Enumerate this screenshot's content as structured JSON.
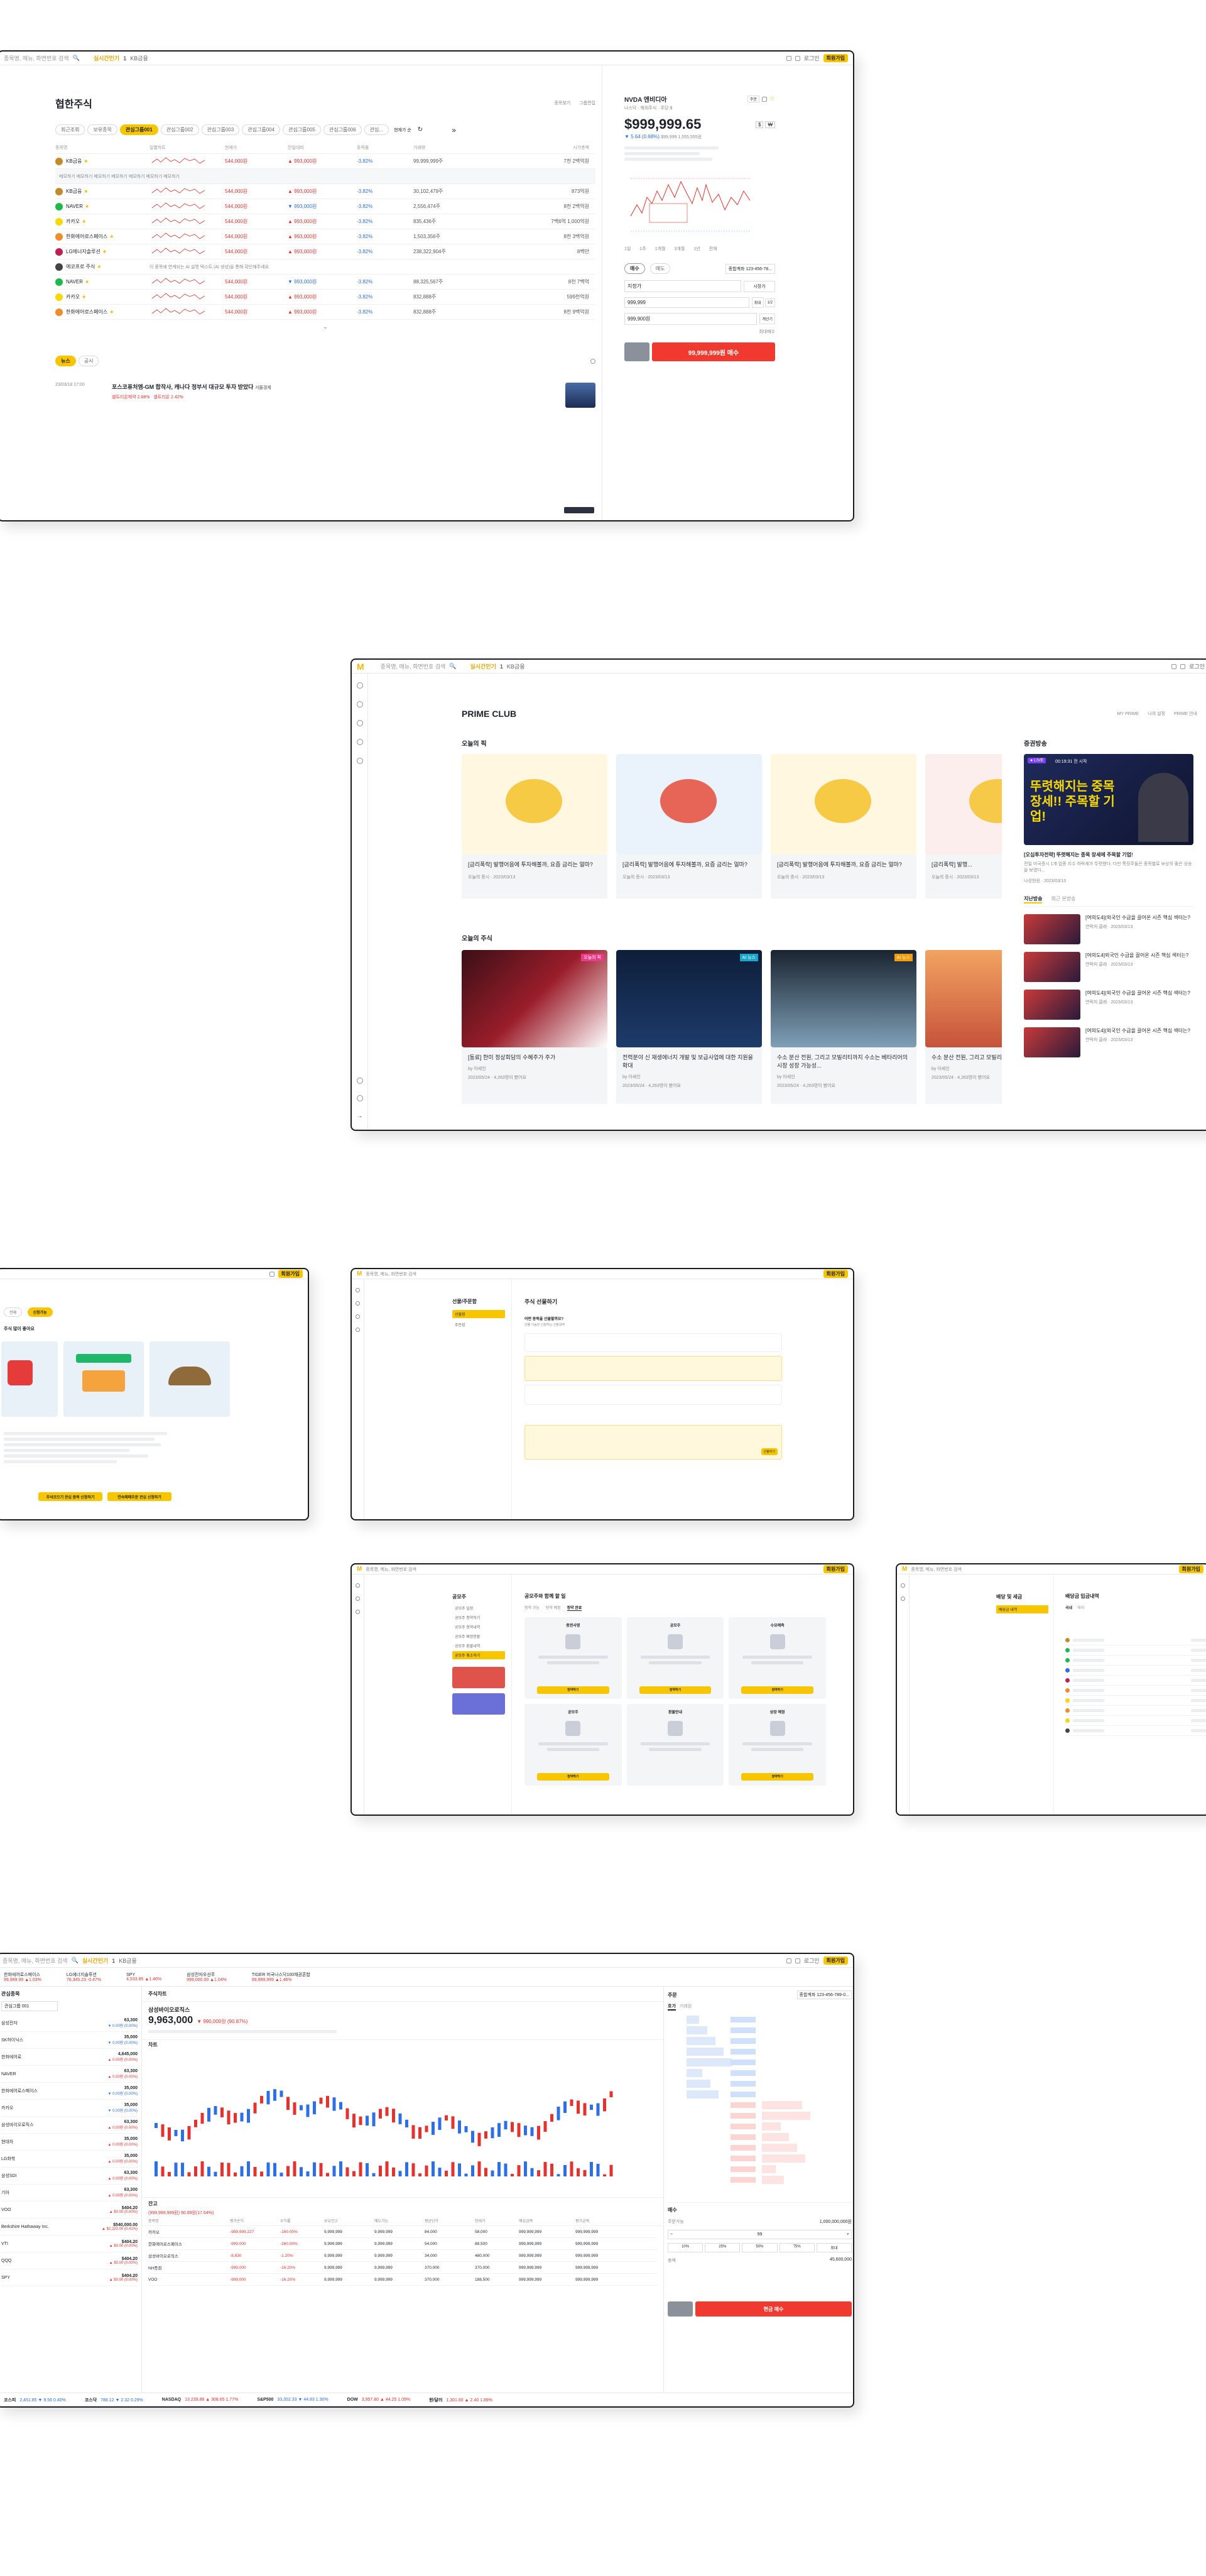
{
  "common": {
    "search_placeholder": "종목명, 메뉴, 화면번호 검색",
    "realtime_label": "실시간인기",
    "realtime_rank": "1",
    "realtime_stock": "KB금융",
    "login_label": "로그인",
    "signup_label": "회원가입",
    "logo_letter": "M"
  },
  "screen1": {
    "page_title": "협한주식",
    "header_links": [
      "종목찾기",
      "그룹편집"
    ],
    "tabs": [
      "최근조회",
      "보유종목",
      "관심그룹001",
      "관심그룹002",
      "관심그룹003",
      "관심그룹004",
      "관심그룹005",
      "관심그룹006",
      "관심..."
    ],
    "sort_label": "현재가 순",
    "columns": [
      "종목명",
      "일별차트",
      "현재가",
      "전일대비",
      "등락률",
      "거래량",
      "시가총액"
    ],
    "rows": [
      {
        "name": "KB금융",
        "price": "544,000원",
        "change": "▲ 993,000원",
        "rate": "-3.82%",
        "volume": "99,999,999주",
        "cap": "7천 2백억원",
        "color": "#c28a2b",
        "type": "stock"
      },
      {
        "name": "",
        "note": "메모하기 메모하기 메모하기 메모하기 메모하기 메모하기 메모하기",
        "type": "memo"
      },
      {
        "name": "KB금융",
        "price": "544,000원",
        "change": "▲ 993,000원",
        "rate": "-3.82%",
        "volume": "30,102,479주",
        "cap": "873억원",
        "color": "#c28a2b",
        "type": "stock"
      },
      {
        "name": "NAVER",
        "price": "544,000원",
        "change": "▼ 993,000원",
        "rate": "-3.82%",
        "volume": "2,556,474주",
        "cap": "8천 2백억원",
        "color": "#1fb84a",
        "type": "stock"
      },
      {
        "name": "카카오",
        "price": "544,000원",
        "change": "▲ 993,000원",
        "rate": "-3.82%",
        "volume": "835,436주",
        "cap": "7백6억 1,000억원",
        "color": "#f7d800",
        "type": "stock"
      },
      {
        "name": "한화에어로스페이스",
        "price": "544,000원",
        "change": "▲ 993,000원",
        "rate": "-3.82%",
        "volume": "1,503,356주",
        "cap": "8천 3백억원",
        "color": "#f08c2a",
        "type": "stock"
      },
      {
        "name": "LG에너지솔루션",
        "price": "544,000원",
        "change": "▲ 993,000원",
        "rate": "-3.82%",
        "volume": "238,322,904주",
        "cap": "8백만",
        "color": "#c01f4f",
        "type": "stock"
      },
      {
        "name": "에코프로 주식",
        "note": "이 종목에 연계되는 AI 설명 텍스트 (AI 생성)을 통해 확인해주세요",
        "color": "#444",
        "type": "info"
      },
      {
        "name": "NAVER",
        "price": "544,000원",
        "change": "▼ 993,000원",
        "rate": "-3.82%",
        "volume": "88,325,567주",
        "cap": "8천 7백억",
        "color": "#1fb84a",
        "type": "stock"
      },
      {
        "name": "카카오",
        "price": "544,000원",
        "change": "▲ 993,000원",
        "rate": "-3.82%",
        "volume": "832,888주",
        "cap": "599천억원",
        "color": "#f7d800",
        "type": "stock"
      },
      {
        "name": "한화에어로스페이스",
        "price": "544,000원",
        "change": "▲ 993,000원",
        "rate": "-3.82%",
        "volume": "832,888주",
        "cap": "8천 9백억원",
        "color": "#f08c2a",
        "type": "stock"
      }
    ],
    "news_tabs": [
      "뉴스",
      "공시"
    ],
    "news_date": "23/03/18 17:00",
    "news_headline": "포스코퓨처엠-GM 합작사, 캐나다 정부서 대규모 투자 받았다",
    "news_source": "서울경제",
    "news_related": [
      "셀트리온제약 2.88%",
      "셀트리온 2.42%"
    ],
    "side": {
      "stock_name": "NVDA 엔비디아",
      "stock_sub": "나스닥 · 해외주식 · 주당 $",
      "price": "$999,999.65",
      "change": "▼ 5.64 (0.68%)",
      "change_extra": "$99,999 1,555,555원",
      "chart_labels": [
        "1일",
        "1주",
        "1개월",
        "3개월",
        "1년",
        "전체"
      ],
      "order_tabs": [
        "매수",
        "매도"
      ],
      "account": "종합계좌 123-456-78...",
      "qty_label": "지정가",
      "price_val": "999,999",
      "qty_val": "999,900원",
      "qty_buttons": [
        "10%",
        "25%",
        "50%",
        "전체"
      ],
      "buy_button": "99,999,999원 매수",
      "max_buy": "최대매수"
    }
  },
  "screen2": {
    "title": "PRIME CLUB",
    "top_links": [
      "MY PRIME",
      "나의 설정",
      "PRIME 안내"
    ],
    "section1": "오늘의 픽",
    "picks": [
      {
        "title": "[금리폭락] 발행어음에 투자해볼까, 요즘 금리는 얼마?",
        "meta": "오늘의 증시 · 2023/03/13",
        "bg": "#fff7df"
      },
      {
        "title": "[금리폭락] 발행어음에 투자해볼까, 요즘 금리는 얼마?",
        "meta": "오늘의 증시 · 2023/03/13",
        "bg": "#eaf3fb"
      },
      {
        "title": "[금리폭락] 발행어음에 투자해볼까, 요즘 금리는 얼마?",
        "meta": "오늘의 증시 · 2023/03/13",
        "bg": "#fff7df"
      },
      {
        "title": "[금리폭락] 발행...",
        "meta": "오늘의 증시 · 2023/03/13",
        "bg": "#fdeeee"
      }
    ],
    "section2": "오늘의 주식",
    "stocks": [
      {
        "title": "[동료] 한미 정상회담의 수혜주가 주가",
        "by": "by 아세인",
        "meta": "2023/05/24 · 4,263명이 봤어요",
        "tag": "오늘의 픽",
        "tagcolor": "#e93b8a"
      },
      {
        "title": "전력분야 신 재생에너지 개발 및 보급사업에 대한 지원을 확대",
        "by": "by 아세인",
        "meta": "2023/05/24 · 4,263명이 봤어요",
        "tag": "AI 뉴스",
        "tagcolor": "#19a7c9"
      },
      {
        "title": "수소 분산 전원, 그리고 모빌리티까지 수소는 베타리어의 시장 성장 가능성...",
        "by": "by 아세인",
        "meta": "2023/05/24 · 4,263명이 봤어요",
        "tag": "AI 뉴스",
        "tagcolor": "#f59c0b"
      },
      {
        "title": "수소 분산 전원, 그리고 모빌리티까지 수소는 베타리어...",
        "by": "by 아세인",
        "meta": "2023/05/24 · 4,263명이 봤어요",
        "tag": "",
        "tagcolor": ""
      }
    ],
    "broadcast_title": "증권방송",
    "live_label": "● LIVE",
    "live_time": "00:19:31 전 시작",
    "broadcast_headline": "뚜렷해지는 중목 장세!! 주목할 기업!",
    "broadcast_sub": "[오십투자전략] 뚜렷해지는 종목 장세에 주목할 기업!",
    "broadcast_desc": "전일 미국증시 1개 업종 지수 하락세가 뚜렷했다. 다만 특징주들은 종목별로 보상의 좋은 상승을 보였다...",
    "broadcast_date": "나성현원 · 2023/03/13",
    "broadcast_tabs": [
      "지난방송",
      "최근 본방송"
    ],
    "past": [
      {
        "title": "[여의도4](외국인 수급을 끌어온 시즌 핵심 섹터는?",
        "meta": "연락처 클래 · 2023/03/13"
      },
      {
        "title": "[여의도4]외국인 수급을 끌어온 시즌 핵심 섹터는?",
        "meta": "연락처 클래 · 2023/03/13"
      },
      {
        "title": "[여의도4](외국인 수급을 끌어온 시즌 핵심 섹터는?",
        "meta": "연락처 클래 · 2023/03/13"
      },
      {
        "title": "[여의도4](외국인 수급을 끌어온 시즌 핵심 섹터는?",
        "meta": "연락처 클래 · 2023/03/13"
      }
    ]
  },
  "screen3": {
    "chips": [
      "전체",
      "신청가능"
    ],
    "subhead": "주식 많이 좋아요",
    "btn1": "주식모으기 관심 종목 신청하기",
    "btn2": "연속매매주문 관심 신청하기"
  },
  "screen4": {
    "menu_title": "선물/주문함",
    "menu_items": [
      "선물함",
      "주문함"
    ],
    "title": "주식 선물하기",
    "subtitle": "어떤 종목을 선물할까요?",
    "notice": "선물 가능한 신청하는 신청내역",
    "btn": "선물하기"
  },
  "screen5": {
    "menu_title": "공모주",
    "menu_items": [
      "공모주 일정",
      "공모주 청약하기",
      "공모주 청약내역",
      "공모주 배정현황",
      "공모주 환불내역",
      "공모주 취소하기"
    ],
    "title": "공모주와 함께 할 일",
    "tabs": [
      "청약 가능",
      "청약 예정",
      "청약 완료"
    ],
    "cards": [
      "증권사명",
      "공모주",
      "수요예측",
      "공모주",
      "환불안내",
      "상장 예정"
    ],
    "btn": "청약하기"
  },
  "screen6": {
    "menu_title": "배당 및 세금",
    "menu_items": [
      "배당금 내역"
    ],
    "title": "배당금 입금내역",
    "tabs": [
      "국내",
      "해외"
    ]
  },
  "screen7": {
    "ticker_bar": [
      {
        "name": "한화에어로스페이스",
        "val": "99,999.99 ▲1.03%"
      },
      {
        "name": "LG에너지솔루션",
        "val": "78,345.23 -0.47%"
      },
      {
        "name": "SPY",
        "val": "4,533.85 ▲1.46%"
      },
      {
        "name": "삼성전자우선주",
        "val": "999,000.00 ▲1.04%"
      },
      {
        "name": "TIGER 미국나스닥100채권혼합",
        "val": "99,999,999 ▲1.46%"
      }
    ],
    "watch_title": "관심종목",
    "watch_group": "관심그룹 001",
    "watch": [
      {
        "name": "삼성전자",
        "price": "63,300",
        "chg": "▼ 0.00원 (0.00%)"
      },
      {
        "name": "SK하이닉스",
        "price": "35,000",
        "chg": "▼ 0.00원 (0.00%)"
      },
      {
        "name": "한화에어로",
        "price": "4,645,000",
        "chg": "▲ 0.00원 (0.00%)"
      },
      {
        "name": "NAVER",
        "price": "63,300",
        "chg": "▲ 0.00원 (0.00%)"
      },
      {
        "name": "한화에어로스페이스",
        "price": "35,000",
        "chg": "▼ 0.00원 (0.00%)"
      },
      {
        "name": "카카오",
        "price": "35,000",
        "chg": "▼ 0.00원 (0.00%)"
      },
      {
        "name": "삼성바이오로직스",
        "price": "63,300",
        "chg": "▲ 0.00원 (0.00%)"
      },
      {
        "name": "현대차",
        "price": "35,000",
        "chg": "▲ 0.00원 (0.00%)"
      },
      {
        "name": "LG화학",
        "price": "35,000",
        "chg": "▲ 0.00원 (0.00%)"
      },
      {
        "name": "삼성SDI",
        "price": "63,300",
        "chg": "▲ 0.00원 (0.00%)"
      },
      {
        "name": "기아",
        "price": "63,300",
        "chg": "▲ 0.00원 (0.00%)"
      },
      {
        "name": "VOO",
        "price": "$404.20",
        "chg": "▲ $0.00 (0.00%)"
      },
      {
        "name": "Berkshire Hathaway Inc.",
        "price": "$540,000.00",
        "chg": "▲ $2,220.00 (0.41%)"
      },
      {
        "name": "VTI",
        "price": "$404.20",
        "chg": "▲ $0.00 (0.00%)"
      },
      {
        "name": "QQQ",
        "price": "$404.20",
        "chg": "▲ $0.00 (0.00%)"
      },
      {
        "name": "SPY",
        "price": "$404.20",
        "chg": "▲ $0.00 (0.00%)"
      }
    ],
    "main_title": "주식차트",
    "stock_name": "삼성바이오로직스",
    "stock_price": "9,963,000",
    "stock_chg": "▼ 990,000원 (90.87%)",
    "chart_section": "차트",
    "holdings_title": "잔고",
    "holdings_summary": "(999,999,999원) 90.89원(17.64%)",
    "holdings_cols": [
      "종목명",
      "평가손익",
      "수익률",
      "보유잔고",
      "매도가능",
      "평균단가",
      "현재가",
      "매입금액",
      "평가금액"
    ],
    "holdings": [
      {
        "name": "카카오",
        "pl": "-999,999,227",
        "rate": "-160.00%",
        "qty": "9,999,999",
        "avail": "9,999,999",
        "avg": "84,000",
        "cur": "58,000",
        "buy": "999,999,999",
        "eval": "999,999,999"
      },
      {
        "name": "한화에어로스페이스",
        "pl": "-999,000",
        "rate": "-260.00%",
        "qty": "9,999,999",
        "avail": "9,999,999",
        "avg": "54,000",
        "cur": "88,500",
        "buy": "999,999,999",
        "eval": "999,999,999"
      },
      {
        "name": "삼성바이오로직스",
        "pl": "-8,830",
        "rate": "-1.20%",
        "qty": "9,999,999",
        "avail": "9,999,999",
        "avg": "34,000",
        "cur": "480,000",
        "buy": "999,999,999",
        "eval": "999,999,999"
      },
      {
        "name": "NH증권",
        "pl": "-999,000",
        "rate": "-16.20%",
        "qty": "9,999,999",
        "avail": "9,999,999",
        "avg": "370,000",
        "cur": "370,000",
        "buy": "999,999,999",
        "eval": "999,999,999"
      },
      {
        "name": "VOO",
        "pl": "-999,000",
        "rate": "-16.20%",
        "qty": "9,999,999",
        "avail": "9,999,999",
        "avg": "370,000",
        "cur": "188,500",
        "buy": "999,999,999",
        "eval": "999,999,999"
      }
    ],
    "order_title": "주문",
    "order_account": "종합계좌 123-456-789-0...",
    "order_tabs": [
      "호가",
      "거래원"
    ],
    "order_side": "매수",
    "order_buttons": [
      "10%",
      "25%",
      "50%",
      "75%",
      "최대"
    ],
    "order_amount": "1,000,000,000원",
    "order_qty": "99",
    "order_total": "45,600,000",
    "order_btn": "현금 매수",
    "market_bar": [
      {
        "name": "코스피",
        "val": "2,451.85 ▼ 9.56 0.40%"
      },
      {
        "name": "코스닥",
        "val": "788.12 ▼ 2.32 0.29%"
      },
      {
        "name": "NASDAQ",
        "val": "13,239.88 ▲ 308.65 1.77%"
      },
      {
        "name": "S&P500",
        "val": "33,352.33 ▼ 44.83 1.30%"
      },
      {
        "name": "DOW",
        "val": "3,957.80 ▲ 44.25 1.09%"
      },
      {
        "name": "원/달러",
        "val": "1,301.60 ▲ 2.40 1.89%"
      }
    ]
  }
}
